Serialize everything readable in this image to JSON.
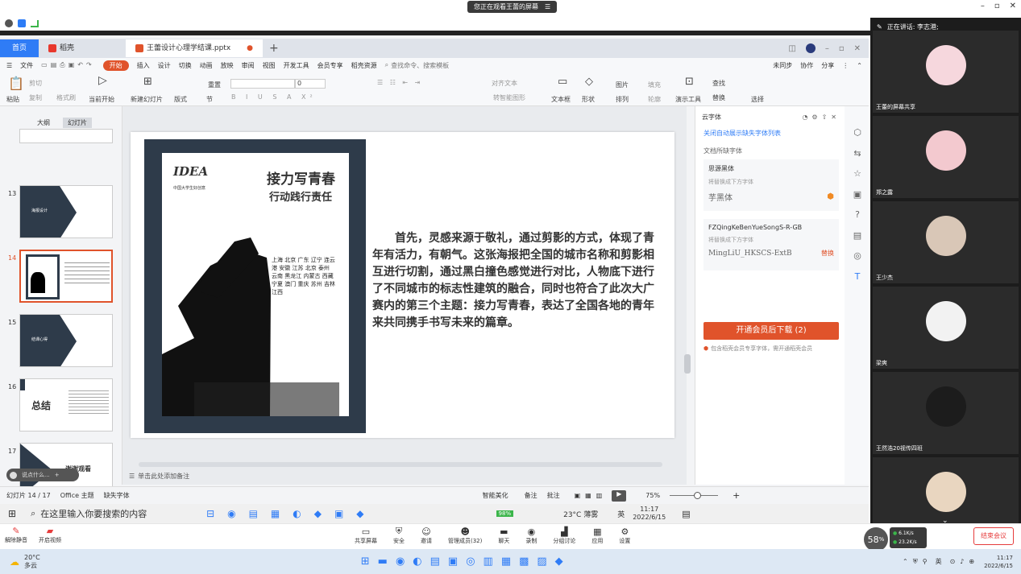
{
  "share": {
    "banner_text": "您正在观看王蕾的屏幕",
    "banner_icon": "list-icon"
  },
  "window_controls": [
    "–",
    "▫",
    "✕"
  ],
  "wps": {
    "tabs": [
      {
        "label": "首页"
      },
      {
        "label": "稻壳"
      },
      {
        "label": "王蕾设计心理学结课.pptx"
      }
    ],
    "menu": [
      "文件",
      "开始",
      "插入",
      "设计",
      "切换",
      "动画",
      "放映",
      "审阅",
      "视图",
      "开发工具",
      "会员专享",
      "稻壳资源"
    ],
    "search_placeholder": "查找命令、搜索模板",
    "menu_right": [
      "未同步",
      "协作",
      "分享"
    ],
    "ribbon": {
      "paste": "粘贴",
      "cut": "剪切",
      "copy": "复制",
      "format_painter": "格式刷",
      "from_current": "当前开始",
      "new_slide": "新建幻灯片",
      "layout": "版式",
      "section": "节",
      "reset": "重置",
      "font_size": "0",
      "align_text": "对齐文本",
      "convert_smartart": "转智能图形",
      "textbox": "文本框",
      "shape": "形状",
      "picture": "图片",
      "arrange": "排列",
      "fill": "填充",
      "outline": "轮廓",
      "presenter": "演示工具",
      "find": "查找",
      "replace": "替换",
      "select": "选择"
    },
    "panel_tabs": [
      "大纲",
      "幻灯片"
    ],
    "thumbnails": [
      {
        "num": "13",
        "title": "海报设计"
      },
      {
        "num": "14",
        "title": ""
      },
      {
        "num": "15",
        "title": "结课心得"
      },
      {
        "num": "16",
        "title": "总结"
      },
      {
        "num": "17",
        "title": "谢谢观看"
      }
    ],
    "slide": {
      "poster_logo": "IDEA",
      "poster_logo_sub": "中国大学生好创意",
      "poster_title": "接力写青春",
      "poster_subtitle": "行动践行责任",
      "cities": [
        "上海",
        "北京",
        "广东",
        "辽宁",
        "连云港",
        "安徽",
        "江苏",
        "北京",
        "泰州",
        "云南",
        "黑龙江",
        "内蒙古",
        "西藏",
        "宁夏",
        "澳门",
        "重庆",
        "苏州",
        "吉林",
        "江西"
      ],
      "body_text": "首先，灵感来源于敬礼，通过剪影的方式，体现了青年有活力，有朝气。这张海报把全国的城市名称和剪影相互进行切割，通过黑白撞色感觉进行对比，人物底下进行了不同城市的标志性建筑的融合，同时也符合了此次大广赛内的第三个主题：接力写青春，表达了全国各地的青年来共同携手书写未来的篇章。"
    },
    "notes_placeholder": "单击此处添加备注",
    "speak_placeholder": "说点什么...",
    "fontpanel": {
      "title": "云字体",
      "link": "关闭自动展示缺失字体列表",
      "section": "文档所缺字体",
      "items": [
        {
          "name": "思源黑体",
          "hint": "将替换成下方字体",
          "replacement": "芋黑体",
          "action": ""
        },
        {
          "name": "FZQingKeBenYueSongS-R-GB",
          "hint": "将替换成下方字体",
          "replacement": "MingLiU_HKSCS-ExtB",
          "action": "替换"
        }
      ],
      "download_btn": "开通会员后下载 (2)",
      "member_note": "包含稻壳会员专享字体，需开通稻壳会员"
    },
    "status": {
      "slide_info": "幻灯片 14 / 17",
      "theme": "Office 主题",
      "missing_font": "缺失字体",
      "smart": "智能美化",
      "notes": "备注",
      "comments": "批注",
      "zoom": "75%"
    }
  },
  "taskbar1": {
    "search_placeholder": "在这里输入你要搜索的内容",
    "battery": "98%",
    "weather": "23°C 薄雾",
    "lang": "英",
    "time": "11:17",
    "date": "2022/6/15"
  },
  "meeting": {
    "left": [
      {
        "label": "解除静音",
        "icon": "mic-off-icon"
      },
      {
        "label": "开启视频",
        "icon": "video-off-icon"
      }
    ],
    "center": [
      {
        "label": "共享屏幕",
        "icon": "share-screen-icon"
      },
      {
        "label": "安全",
        "icon": "shield-icon"
      },
      {
        "label": "邀请",
        "icon": "invite-icon"
      },
      {
        "label": "管理成员(32)",
        "icon": "members-icon"
      },
      {
        "label": "聊天",
        "icon": "chat-icon"
      },
      {
        "label": "录制",
        "icon": "record-icon"
      },
      {
        "label": "分组讨论",
        "icon": "breakout-icon"
      },
      {
        "label": "应用",
        "icon": "apps-icon"
      },
      {
        "label": "设置",
        "icon": "settings-icon"
      }
    ],
    "cpu": "58",
    "cpu_unit": "%",
    "net_up": "6.1",
    "net_down": "23.2",
    "net_unit": "K/s",
    "end_btn": "结束会议"
  },
  "taskbar2": {
    "temp": "20°C",
    "cond": "多云",
    "lang": "英",
    "time": "11:17",
    "date": "2022/6/15"
  },
  "participants": {
    "speaking": "正在讲话: 李志港;",
    "tiles": [
      {
        "name": "王蕾的屏幕共享",
        "color": "#f6d7dd"
      },
      {
        "name": "郑之露",
        "color": "#f3c9cf"
      },
      {
        "name": "王少杰",
        "color": "#d9c7b7"
      },
      {
        "name": "梁爽",
        "color": "#f2f2f2"
      },
      {
        "name": "王然浩20视传四班",
        "color": "#1c1c1c"
      },
      {
        "name": "",
        "color": "#e9d6c0"
      }
    ]
  }
}
